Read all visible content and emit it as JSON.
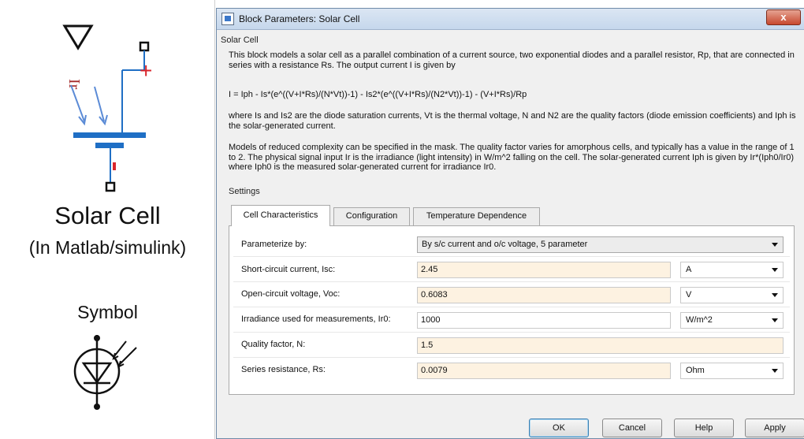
{
  "left_panel": {
    "title": "Solar Cell",
    "subtitle": "(In Matlab/simulink)",
    "symbol_label": "Symbol",
    "ir_label": "Ir",
    "plus_label": "+",
    "minus_label": "-",
    "colors": {
      "port_blue": "#1f6fc5",
      "label_red": "#d9262c",
      "irr_red": "#a52a2a"
    }
  },
  "dialog": {
    "window_title": "Block Parameters: Solar Cell",
    "close_glyph": "x",
    "description": {
      "heading": "Solar Cell",
      "paragraphs": [
        "This block models a solar cell as a parallel combination of a current source, two exponential diodes and a parallel resistor, Rp, that are connected in series with a resistance Rs. The output current I is given by",
        "I = Iph - Is*(e^((V+I*Rs)/(N*Vt))-1) - Is2*(e^((V+I*Rs)/(N2*Vt))-1) - (V+I*Rs)/Rp",
        "where Is and Is2 are the diode saturation currents, Vt is the thermal voltage, N and N2 are the quality factors (diode emission coefficients) and Iph is the solar-generated current.",
        "Models of reduced complexity can be specified in the mask. The quality factor varies for amorphous cells, and typically has a value in the range of 1 to 2. The physical signal input Ir is the irradiance (light intensity) in W/m^2 falling on the cell. The solar-generated current Iph is given by Ir*(Iph0/Ir0) where Iph0 is the measured solar-generated current for irradiance Ir0."
      ]
    },
    "settings_heading": "Settings",
    "tabs": [
      {
        "label": "Cell Characteristics",
        "active": true
      },
      {
        "label": "Configuration",
        "active": false
      },
      {
        "label": "Temperature Dependence",
        "active": false
      }
    ],
    "parameterize": {
      "label": "Parameterize by:",
      "value": "By s/c current and o/c voltage, 5 parameter"
    },
    "params": [
      {
        "label": "Short-circuit current, Isc:",
        "value": "2.45",
        "unit": "A"
      },
      {
        "label": "Open-circuit voltage, Voc:",
        "value": "0.6083",
        "unit": "V"
      },
      {
        "label": "Irradiance used for measurements, Ir0:",
        "value": "1000",
        "unit": "W/m^2"
      },
      {
        "label": "Quality factor, N:",
        "value": "1.5",
        "unit": ""
      },
      {
        "label": "Series resistance, Rs:",
        "value": "0.0079",
        "unit": "Ohm"
      }
    ],
    "buttons": {
      "ok": "OK",
      "cancel": "Cancel",
      "help": "Help",
      "apply": "Apply"
    },
    "colors": {
      "field_bg": "#fdf2e1",
      "close_red": "#c7482e",
      "title_bar": "#c5d7ec"
    }
  }
}
